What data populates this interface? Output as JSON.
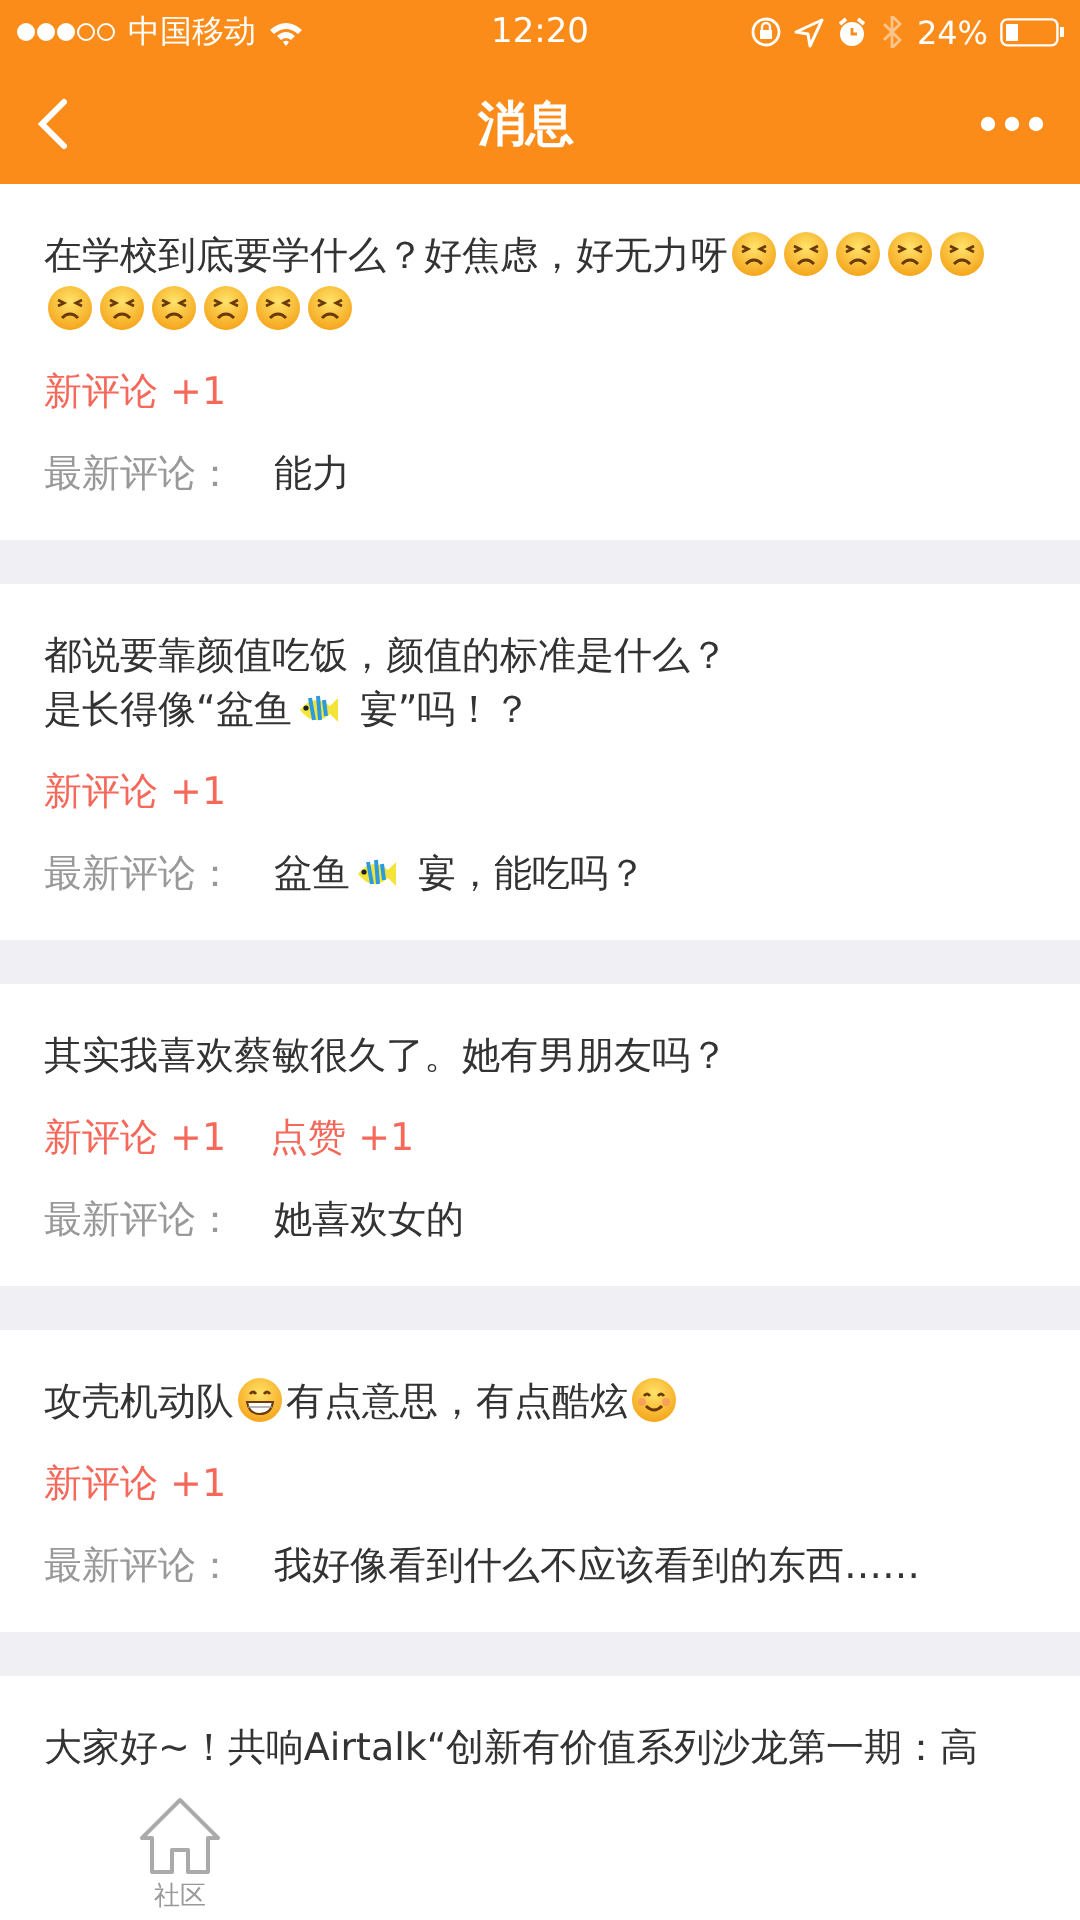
{
  "status_bar": {
    "carrier": "中国移动",
    "time": "12:20",
    "battery": "24%"
  },
  "nav_bar": {
    "title": "消息"
  },
  "messages": [
    {
      "title": [
        {
          "kind": "text",
          "text": "在学校到底要学什么？好焦虑，好无力呀"
        },
        {
          "kind": "persevering"
        },
        {
          "kind": "persevering"
        },
        {
          "kind": "persevering"
        },
        {
          "kind": "persevering"
        },
        {
          "kind": "persevering"
        },
        {
          "kind": "persevering"
        },
        {
          "kind": "persevering"
        },
        {
          "kind": "persevering"
        },
        {
          "kind": "persevering"
        },
        {
          "kind": "persevering"
        },
        {
          "kind": "persevering"
        }
      ],
      "tags": [
        "新评论 +1"
      ],
      "latest_label": "最新评论：",
      "latest": [
        {
          "kind": "text",
          "text": "能力"
        }
      ]
    },
    {
      "title": [
        {
          "kind": "text",
          "text": "都说要靠颜值吃饭，颜值的标准是什么？"
        },
        {
          "kind": "break"
        },
        {
          "kind": "text",
          "text": "是长得像“盆鱼"
        },
        {
          "kind": "fish"
        },
        {
          "kind": "text",
          "text": " 宴”吗！？"
        }
      ],
      "tags": [
        "新评论 +1"
      ],
      "latest_label": "最新评论：",
      "latest": [
        {
          "kind": "text",
          "text": "盆鱼"
        },
        {
          "kind": "fish"
        },
        {
          "kind": "text",
          "text": " 宴，能吃吗？"
        }
      ]
    },
    {
      "title": [
        {
          "kind": "text",
          "text": "其实我喜欢蔡敏很久了。她有男朋友吗？"
        }
      ],
      "tags": [
        "新评论 +1",
        "点赞 +1"
      ],
      "latest_label": "最新评论：",
      "latest": [
        {
          "kind": "text",
          "text": "她喜欢女的"
        }
      ]
    },
    {
      "title": [
        {
          "kind": "text",
          "text": "攻壳机动队"
        },
        {
          "kind": "grin"
        },
        {
          "kind": "text",
          "text": "有点意思，有点酷炫"
        },
        {
          "kind": "smile"
        }
      ],
      "tags": [
        "新评论 +1"
      ],
      "latest_label": "最新评论：",
      "latest": [
        {
          "kind": "text",
          "text": "我好像看到什么不应该看到的东西……"
        }
      ]
    },
    {
      "title": [
        {
          "kind": "text",
          "text": "大家好~！共响Airtalk“创新有价值系列沙龙第一期：高"
        }
      ]
    }
  ],
  "tab_bar": {
    "items": [
      {
        "label": "社区"
      }
    ]
  }
}
